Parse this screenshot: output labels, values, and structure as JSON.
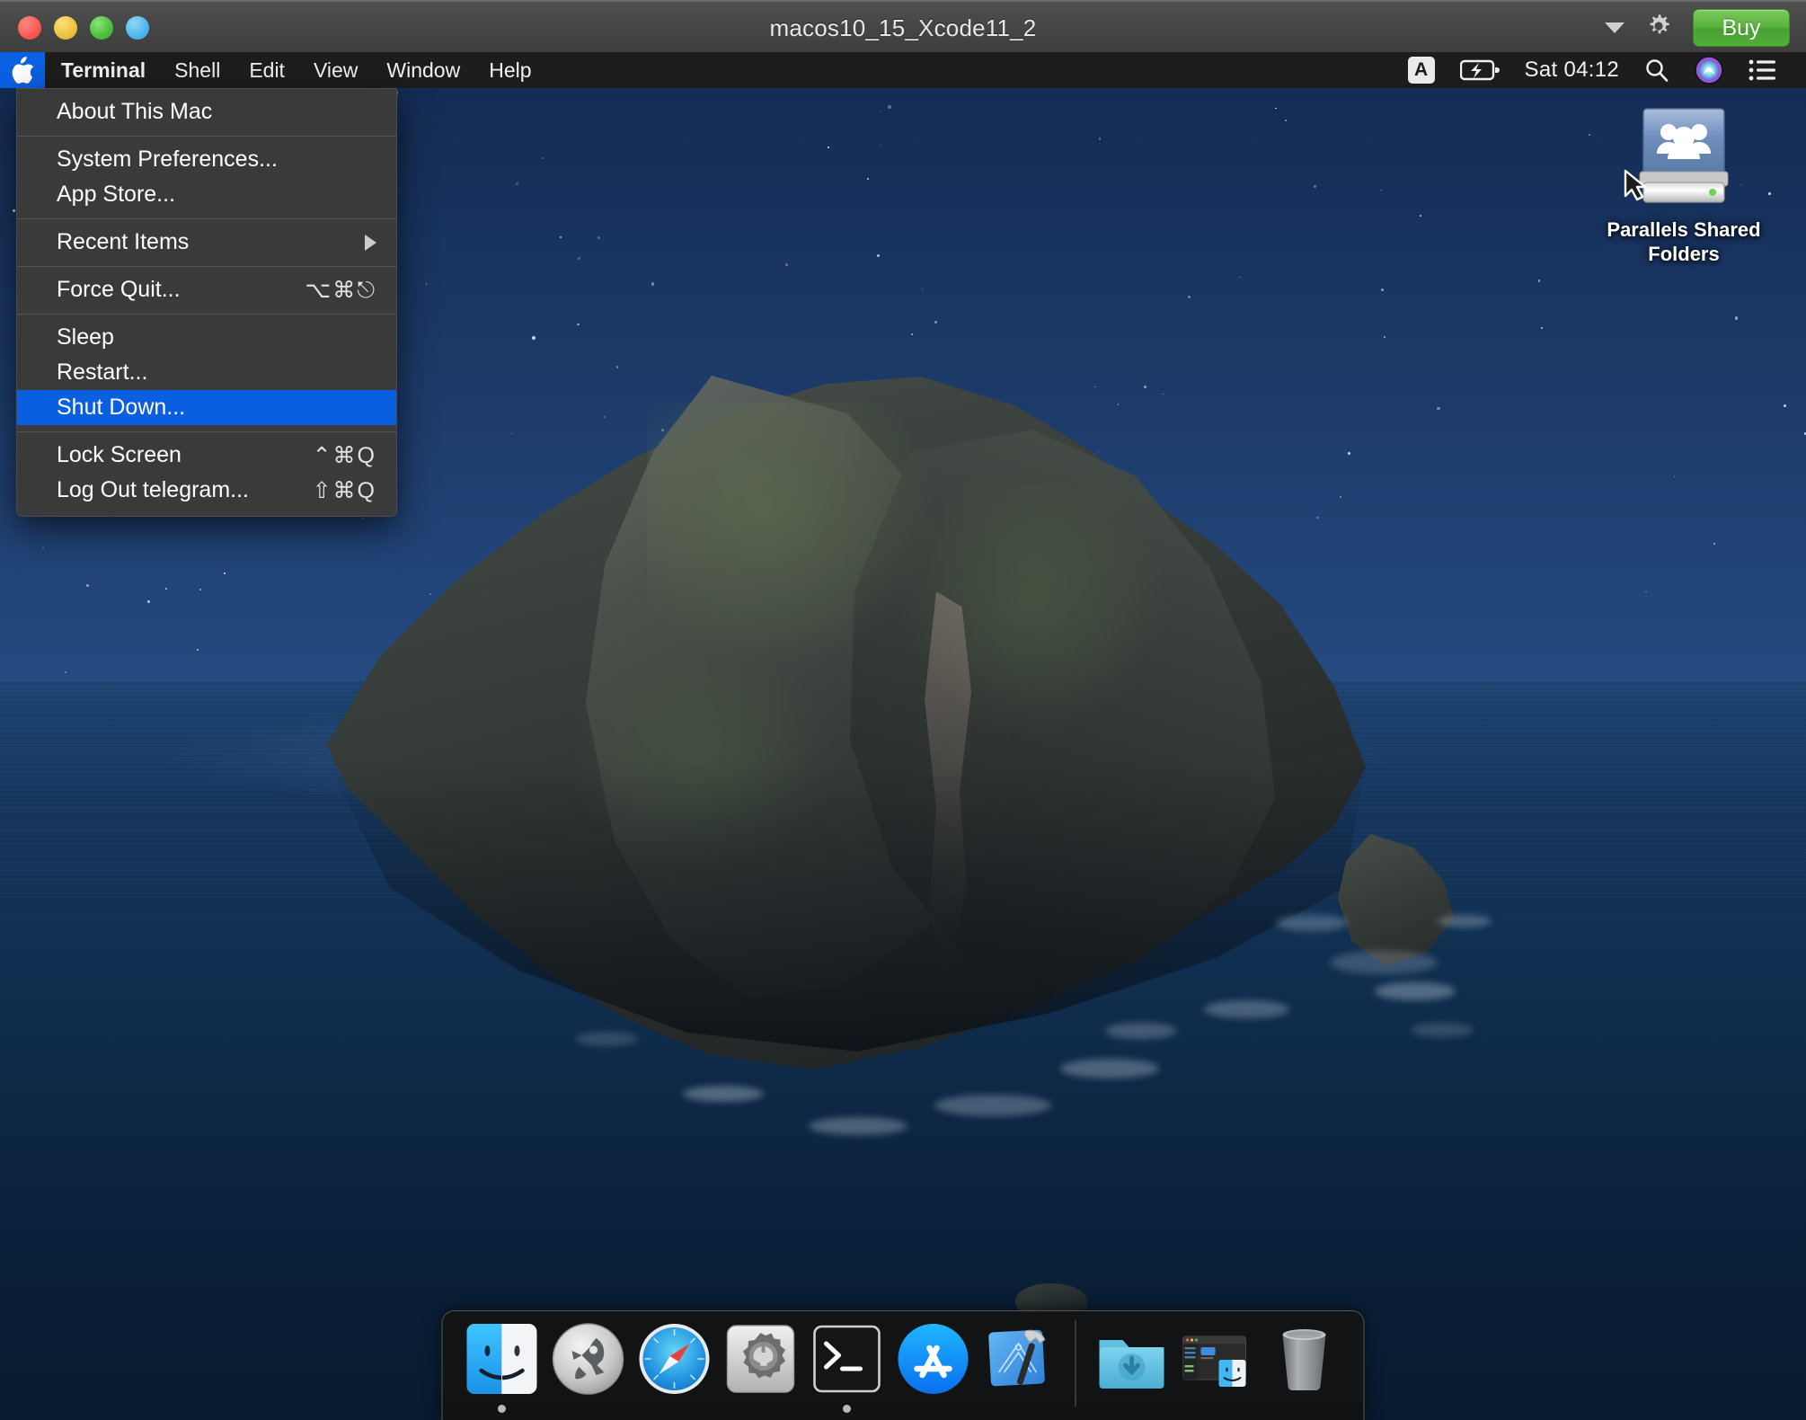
{
  "vm_window": {
    "title": "macos10_15_Xcode11_2",
    "traffic_lights": [
      {
        "name": "close-button",
        "color": "#f9584f"
      },
      {
        "name": "minimize-button",
        "color": "#e9c23c"
      },
      {
        "name": "fullscreen-button",
        "color": "#4cbe3b"
      },
      {
        "name": "coherence-button",
        "color": "#4db7ec"
      }
    ],
    "toolbar_right": {
      "dropdown_icon": "chevron-down-icon",
      "settings_icon": "gear-icon",
      "buy_label": "Buy",
      "buy_color": "#56b13c"
    }
  },
  "menubar": {
    "apple_icon": "apple-logo-icon",
    "apple_highlight_color": "#0a61e3",
    "items": [
      {
        "label": "Terminal",
        "bold": true
      },
      {
        "label": "Shell",
        "bold": false
      },
      {
        "label": "Edit",
        "bold": false
      },
      {
        "label": "View",
        "bold": false
      },
      {
        "label": "Window",
        "bold": false
      },
      {
        "label": "Help",
        "bold": false
      }
    ],
    "status": {
      "input_source": "A",
      "battery_icon": "battery-charging-icon",
      "clock": "Sat 04:12",
      "search_icon": "search-icon",
      "siri_icon": "siri-icon",
      "control_center_icon": "control-center-icon"
    }
  },
  "apple_menu": {
    "highlight_color": "#0a5fe0",
    "groups": [
      [
        {
          "label": "About This Mac",
          "shortcut": "",
          "selected": false,
          "submenu": false
        }
      ],
      [
        {
          "label": "System Preferences...",
          "shortcut": "",
          "selected": false,
          "submenu": false
        },
        {
          "label": "App Store...",
          "shortcut": "",
          "selected": false,
          "submenu": false
        }
      ],
      [
        {
          "label": "Recent Items",
          "shortcut": "",
          "selected": false,
          "submenu": true
        }
      ],
      [
        {
          "label": "Force Quit...",
          "shortcut": "⌥⌘⎋",
          "selected": false,
          "submenu": false
        }
      ],
      [
        {
          "label": "Sleep",
          "shortcut": "",
          "selected": false,
          "submenu": false
        },
        {
          "label": "Restart...",
          "shortcut": "",
          "selected": false,
          "submenu": false
        },
        {
          "label": "Shut Down...",
          "shortcut": "",
          "selected": true,
          "submenu": false
        }
      ],
      [
        {
          "label": "Lock Screen",
          "shortcut": "⌃⌘Q",
          "selected": false,
          "submenu": false
        },
        {
          "label": "Log Out telegram...",
          "shortcut": "⇧⌘Q",
          "selected": false,
          "submenu": false
        }
      ]
    ]
  },
  "desktop": {
    "wallpaper_name": "catalina-night-island",
    "icons": [
      {
        "name": "parallels-shared-folders-icon",
        "label_line1": "Parallels Shared",
        "label_line2": "Folders",
        "type": "shared-disk-alias"
      }
    ]
  },
  "dock": {
    "items": [
      {
        "name": "finder",
        "label": "Finder",
        "running": true
      },
      {
        "name": "launchpad",
        "label": "Launchpad",
        "running": false
      },
      {
        "name": "safari",
        "label": "Safari",
        "running": false
      },
      {
        "name": "system-preferences",
        "label": "System Preferences",
        "running": false
      },
      {
        "name": "terminal",
        "label": "Terminal",
        "running": true
      },
      {
        "name": "app-store",
        "label": "App Store",
        "running": false
      },
      {
        "name": "xcode",
        "label": "Xcode",
        "running": false
      }
    ],
    "right_items": [
      {
        "name": "downloads-folder",
        "label": "Downloads"
      },
      {
        "name": "minimized-finder-window",
        "label": "Finder window"
      },
      {
        "name": "trash",
        "label": "Trash"
      }
    ]
  }
}
